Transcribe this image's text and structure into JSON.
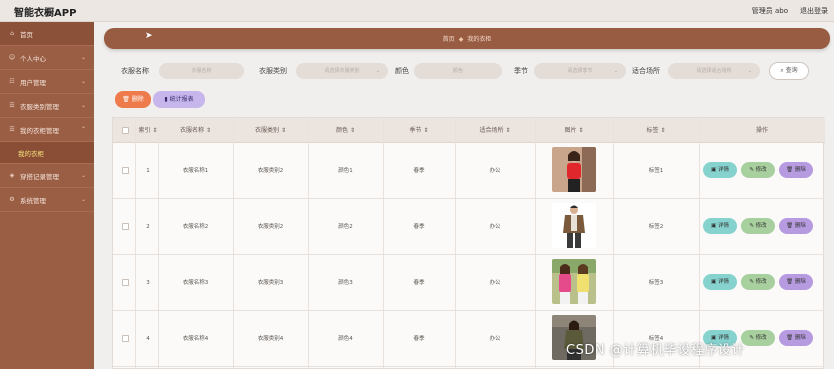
{
  "header": {
    "app_title": "智能衣橱APP",
    "admin_label": "管理员 abo",
    "logout_label": "退出登录"
  },
  "sidebar": {
    "items": [
      {
        "label": "首页",
        "icon": "home-icon"
      },
      {
        "label": "个人中心",
        "icon": "user-icon"
      },
      {
        "label": "用户管理",
        "icon": "users-icon"
      },
      {
        "label": "衣服类别管理",
        "icon": "list-icon"
      },
      {
        "label": "我的衣柜管理",
        "icon": "list-icon"
      },
      {
        "label": "穿搭记录管理",
        "icon": "record-icon"
      },
      {
        "label": "系统管理",
        "icon": "gear-icon"
      }
    ],
    "active_subitem": "我的衣柜"
  },
  "breadcrumb": {
    "home": "首页",
    "current": "我的衣柜"
  },
  "filters": {
    "name_label": "衣服名称",
    "name_placeholder": "衣服名称",
    "category_label": "衣服类别",
    "category_placeholder": "请选择衣服类别",
    "color_label": "颜色",
    "color_placeholder": "颜色",
    "season_label": "季节",
    "season_placeholder": "请选择季节",
    "occasion_label": "适合场所",
    "occasion_placeholder": "请选择适合场所",
    "query_label": "查询"
  },
  "actions": {
    "delete_label": "删除",
    "stats_label": "统计报表"
  },
  "table": {
    "headers": [
      "索引",
      "衣服名称",
      "衣服类别",
      "颜色",
      "季节",
      "适合场所",
      "图片",
      "标签",
      "操作"
    ],
    "rows": [
      {
        "index": "1",
        "name": "衣服名称1",
        "category": "衣服类别2",
        "color": "颜色1",
        "season": "春季",
        "occasion": "办公",
        "tag": "标签1"
      },
      {
        "index": "2",
        "name": "衣服名称2",
        "category": "衣服类别2",
        "color": "颜色2",
        "season": "春季",
        "occasion": "办公",
        "tag": "标签2"
      },
      {
        "index": "3",
        "name": "衣服名称3",
        "category": "衣服类别3",
        "color": "颜色3",
        "season": "春季",
        "occasion": "办公",
        "tag": "标签3"
      },
      {
        "index": "4",
        "name": "衣服名称4",
        "category": "衣服类别4",
        "color": "颜色4",
        "season": "春季",
        "occasion": "办公",
        "tag": "标签4"
      }
    ],
    "ops": {
      "detail": "详情",
      "edit": "修改",
      "delete": "删除"
    }
  },
  "watermark": "CSDN @计算机毕设程序设计",
  "colors": {
    "sidebar": "#9a5e45",
    "breadcrumb": "#985c43",
    "delete_button": "#ee7b4b",
    "stats_button": "#c6b6ec",
    "detail_button": "#86d2ce",
    "edit_button": "#a8cf9e",
    "row_delete_button": "#b79be0",
    "active_subitem": "#f7e27a"
  }
}
